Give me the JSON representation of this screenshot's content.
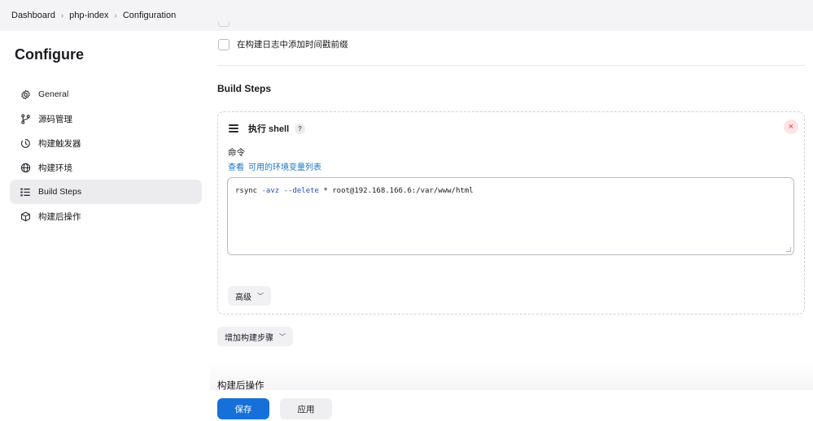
{
  "breadcrumb": [
    "Dashboard",
    "php-index",
    "Configuration"
  ],
  "sidebar": {
    "title": "Configure",
    "items": [
      {
        "label": "General",
        "icon": "gear-icon"
      },
      {
        "label": "源码管理",
        "icon": "branch-icon"
      },
      {
        "label": "构建触发器",
        "icon": "trigger-icon"
      },
      {
        "label": "构建环境",
        "icon": "globe-icon"
      },
      {
        "label": "Build Steps",
        "icon": "list-icon",
        "active": true
      },
      {
        "label": "构建后操作",
        "icon": "cube-icon"
      }
    ]
  },
  "main": {
    "timestamp_checkbox_label": "在构建日志中添加时间戳前缀",
    "build_steps_title": "Build Steps",
    "step": {
      "title": "执行 shell",
      "help": "?",
      "close": "×",
      "command_label": "命令",
      "env_link_prefix": "查看",
      "env_link_text": "可用的环境变量列表",
      "command": {
        "cmd": "rsync",
        "opt1": "-avz",
        "opt2": "--delete",
        "rest": "* root@192.168.166.6:/var/www/html"
      },
      "advanced_label": "高级"
    },
    "add_step_label": "增加构建步骤",
    "post_build_title": "构建后操作",
    "save_label": "保存",
    "apply_label": "应用"
  },
  "colors": {
    "primary": "#1570d9",
    "link": "#1a73c8",
    "danger": "#e0313f",
    "nav_active_bg": "#ececef"
  }
}
